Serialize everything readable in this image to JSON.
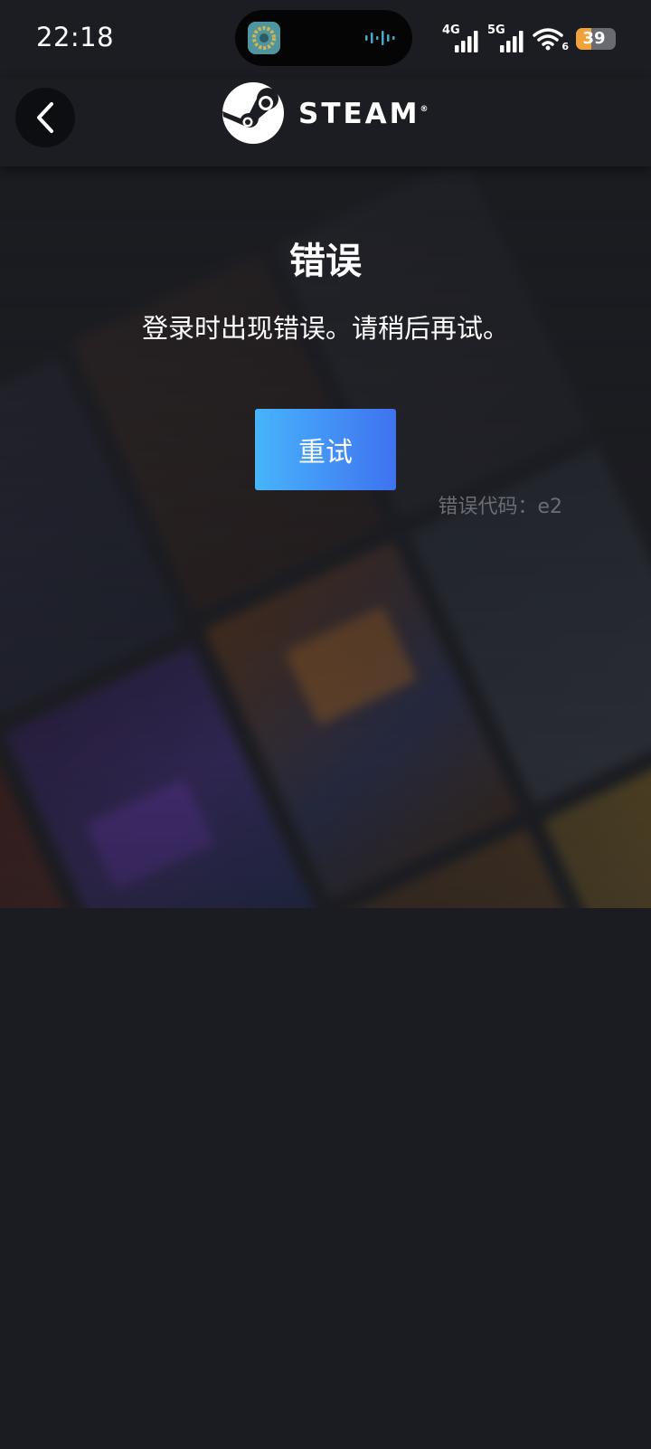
{
  "status_bar": {
    "time": "22:18",
    "network_1": "4G",
    "network_2": "5G",
    "wifi_badge": "6",
    "battery_level": "39",
    "battery_fill_fraction": 0.39
  },
  "header": {
    "back_icon": "chevron-left-icon",
    "logo_text": "STEAM",
    "logo_reg": "®"
  },
  "error": {
    "title": "错误",
    "message": "登录时出现错误。请稍后再试。",
    "retry_label": "重试",
    "code_text": "错误代码：e2"
  },
  "colors": {
    "background": "#1b1c21",
    "retry_gradient_start": "#47b4fb",
    "retry_gradient_end": "#3f72f0",
    "error_code": "#6b6d73",
    "battery": "#f2a23a"
  }
}
